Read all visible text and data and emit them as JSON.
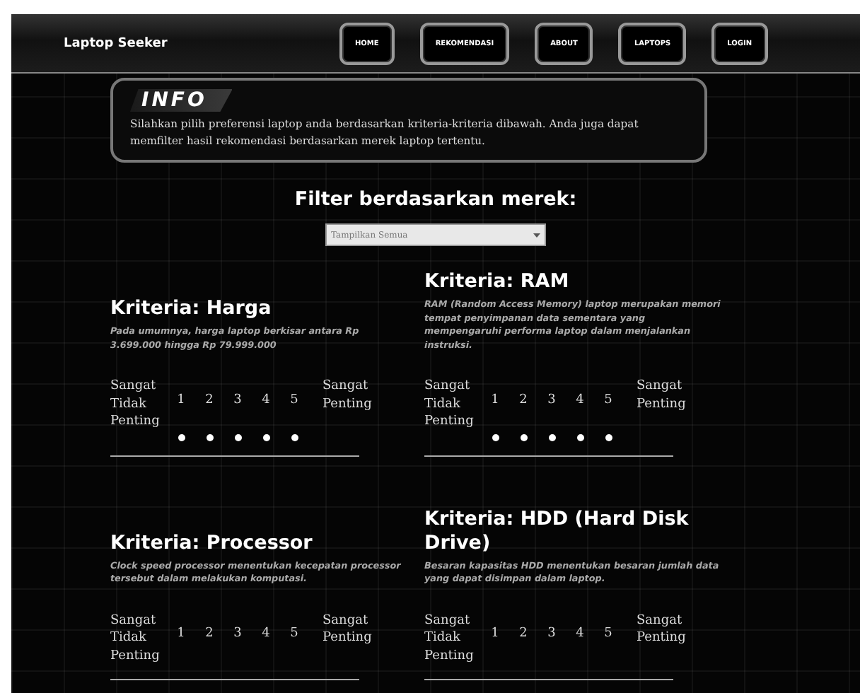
{
  "navbar": {
    "brand": "Laptop Seeker",
    "links": [
      {
        "label": "HOME"
      },
      {
        "label": "REKOMENDASI"
      },
      {
        "label": "ABOUT"
      },
      {
        "label": "LAPTOPS"
      },
      {
        "label": "LOGIN"
      }
    ]
  },
  "info": {
    "badge": "INFO",
    "text": "Silahkan pilih preferensi laptop anda berdasarkan kriteria-kriteria dibawah. Anda juga dapat memfilter hasil rekomendasi berdasarkan merek laptop tertentu."
  },
  "filter": {
    "title": "Filter berdasarkan merek:",
    "value": "Tampilkan Semua"
  },
  "criteria": [
    {
      "title": "Kriteria: Harga",
      "description": "Pada umumnya, harga laptop berkisar antara Rp 3.699.000 hingga Rp 79.999.000",
      "low_label": "Sangat Tidak Penting",
      "high_label": "Sangat Penting",
      "options": [
        {
          "label": "1",
          "selected": false
        },
        {
          "label": "2",
          "selected": false
        },
        {
          "label": "3",
          "selected": false
        },
        {
          "label": "4",
          "selected": false
        },
        {
          "label": "5",
          "selected": false
        }
      ]
    },
    {
      "title": "Kriteria: RAM",
      "description": "RAM (Random Access Memory) laptop merupakan memori tempat penyimpanan data sementara yang mempengaruhi performa laptop dalam menjalankan instruksi.",
      "low_label": "Sangat Tidak Penting",
      "high_label": "Sangat Penting",
      "options": [
        {
          "label": "1",
          "selected": false
        },
        {
          "label": "2",
          "selected": false
        },
        {
          "label": "3",
          "selected": false
        },
        {
          "label": "4",
          "selected": false
        },
        {
          "label": "5",
          "selected": false
        }
      ]
    },
    {
      "title": "Kriteria: Processor",
      "description": "Clock speed processor menentukan kecepatan processor tersebut dalam melakukan komputasi.",
      "low_label": "Sangat Tidak Penting",
      "high_label": "Sangat Penting",
      "options": [
        {
          "label": "1"
        },
        {
          "label": "2"
        },
        {
          "label": "3"
        },
        {
          "label": "4"
        },
        {
          "label": "5"
        }
      ]
    },
    {
      "title": "Kriteria: HDD (Hard Disk Drive)",
      "description": "Besaran kapasitas HDD menentukan besaran jumlah data yang dapat disimpan dalam laptop.",
      "low_label": "Sangat Tidak Penting",
      "high_label": "Sangat Penting",
      "options": [
        {
          "label": "1"
        },
        {
          "label": "2"
        },
        {
          "label": "3"
        },
        {
          "label": "4"
        },
        {
          "label": "5"
        }
      ]
    }
  ]
}
